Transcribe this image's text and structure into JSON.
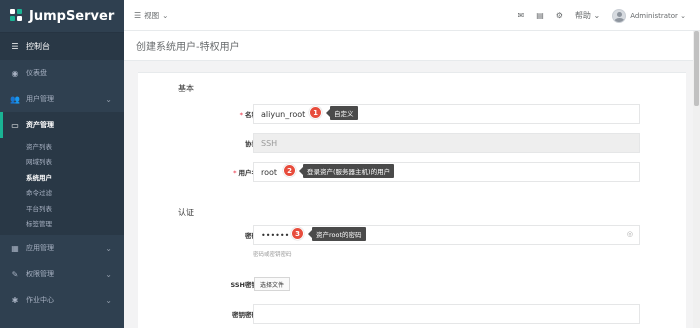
{
  "app": {
    "name": "JumpServer"
  },
  "sidebar": {
    "home": {
      "label": "控制台",
      "icon": "dashboard-icon"
    },
    "items": [
      {
        "label": "仪表盘",
        "icon": "speedometer-icon"
      },
      {
        "label": "用户管理",
        "icon": "users-icon",
        "has_children": true
      },
      {
        "label": "资产管理",
        "icon": "inbox-icon",
        "has_children": true,
        "active": true
      }
    ],
    "asset_sub": [
      {
        "label": "资产列表"
      },
      {
        "label": "网域列表"
      },
      {
        "label": "系统用户",
        "active": true
      },
      {
        "label": "命令过滤"
      },
      {
        "label": "平台列表"
      },
      {
        "label": "标签管理"
      }
    ],
    "bottom_items": [
      {
        "label": "应用管理",
        "icon": "grid-icon",
        "has_children": true
      },
      {
        "label": "权限管理",
        "icon": "edit-icon",
        "has_children": true
      },
      {
        "label": "作业中心",
        "icon": "bug-icon",
        "has_children": true
      }
    ]
  },
  "topbar": {
    "view_label": "视图",
    "help_label": "帮助",
    "user_name": "Administrator"
  },
  "page": {
    "title": "创建系统用户-特权用户"
  },
  "form": {
    "section_basic": "基本",
    "section_auth": "认证",
    "name_label": "名称",
    "name_value": "aliyun_root",
    "protocol_label": "协议",
    "protocol_value": "SSH",
    "username_label": "用户名",
    "username_value": "root",
    "password_label": "密码",
    "password_value": "••••••",
    "password_help": "密码或密钥密码",
    "ssh_key_label": "SSH密钥",
    "ssh_key_button": "选择文件",
    "key_password_label": "密钥密码"
  },
  "annotations": [
    {
      "number": "1",
      "text": "自定义"
    },
    {
      "number": "2",
      "text": "登录资产(服务器主机)的用户"
    },
    {
      "number": "3",
      "text": "资产root的密码"
    }
  ],
  "colors": {
    "sidebar": "#2f4050",
    "accent": "#1ab394",
    "required": "#ed5565",
    "badge": "#e74c3c"
  }
}
